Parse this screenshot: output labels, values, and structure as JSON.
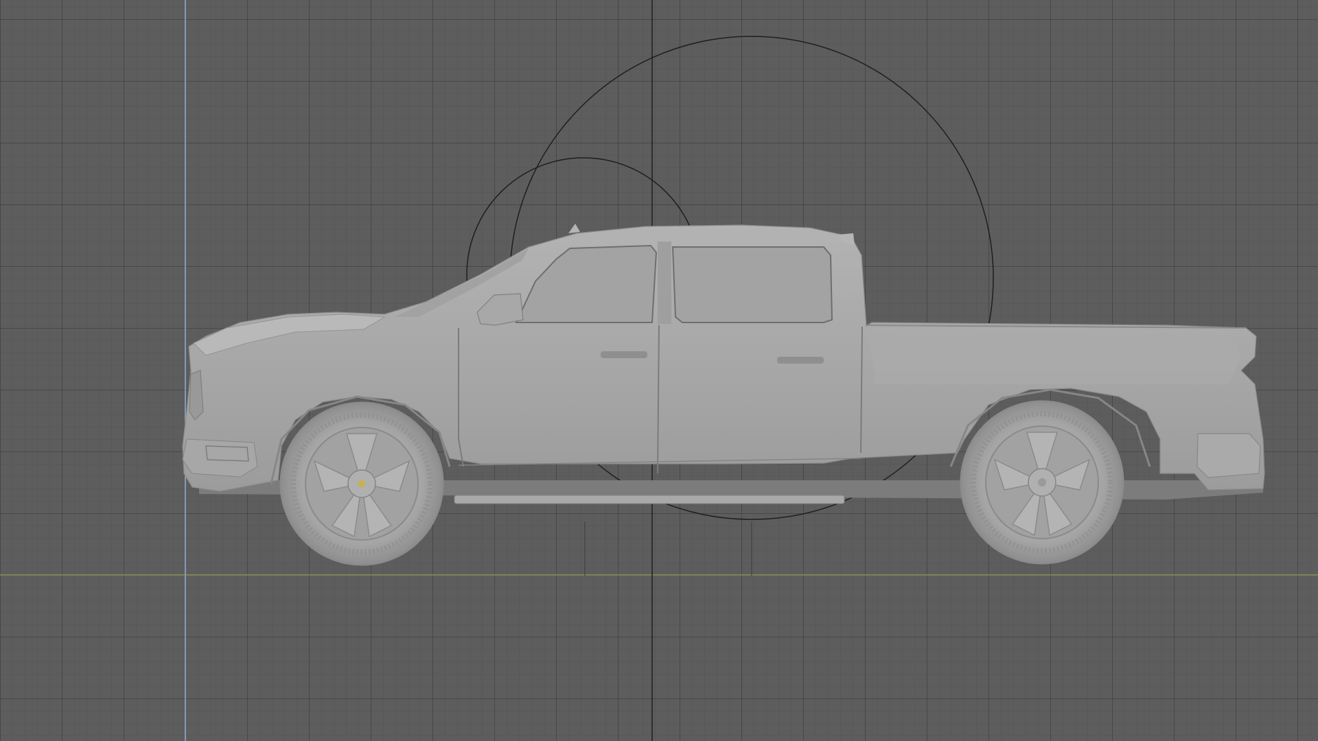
{
  "app": "3D viewport",
  "view": {
    "projection": "orthographic",
    "orientation": "side",
    "grid": true,
    "shading": "solid"
  },
  "axes": [
    {
      "name": "vertical-axis-line",
      "color": "#8fb6dc"
    },
    {
      "name": "horizontal-axis-line",
      "color": "#9aa356"
    }
  ],
  "object": {
    "name": "pickup-truck-model",
    "material_color": "#a9a9a9"
  },
  "overlays": [
    "light-gizmo-large-circle",
    "light-gizmo-small-circle"
  ]
}
